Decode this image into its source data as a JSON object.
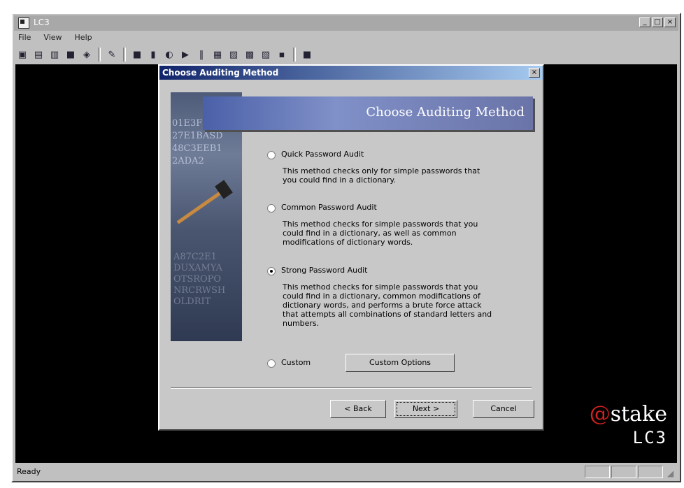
{
  "app": {
    "title": "LC3",
    "window_controls": {
      "minimize": "_",
      "maximize": "□",
      "close": "×"
    }
  },
  "menu": [
    "File",
    "View",
    "Help"
  ],
  "toolbar": {
    "icons": [
      "new-session-icon",
      "open-icon",
      "import-icon",
      "save-icon",
      "export-icon",
      "wizard-icon",
      "stop-icon",
      "pause-icon",
      "options-icon",
      "play-icon",
      "step-icon",
      "chart-icon",
      "report-icon",
      "hash-icon",
      "lock-icon",
      "view-icon",
      "help-icon"
    ]
  },
  "status": {
    "text": "Ready"
  },
  "branding": {
    "at": "@",
    "stake": "stake",
    "product": "LC3"
  },
  "dialog": {
    "title": "Choose Auditing Method",
    "close_label": "×",
    "banner_title": "Choose Auditing Method",
    "image_codes": "01E3F\n27E1BASD\n48C3EEB1\n2ADA2\n",
    "image_codes_bottom": "A87C2E1\nDUXAMYA\nOTSROPO\nNRCRWSH\nOLDRIT",
    "options": [
      {
        "label": "Quick Password Audit",
        "description": "This method checks only for simple passwords that you could find in a dictionary.",
        "selected": false
      },
      {
        "label": "Common Password Audit",
        "description": "This method checks for simple passwords that you could find in a dictionary, as well as common modifications of dictionary words.",
        "selected": false
      },
      {
        "label": "Strong Password Audit",
        "description": "This method checks for simple passwords that you could find in a dictionary, common modifications of dictionary words, and performs a brute force attack that attempts all combinations of standard letters and numbers.",
        "selected": true
      },
      {
        "label": "Custom",
        "description": "",
        "selected": false
      }
    ],
    "custom_options_button": "Custom Options",
    "back_button": "< Back",
    "next_button": "Next >",
    "cancel_button": "Cancel"
  }
}
